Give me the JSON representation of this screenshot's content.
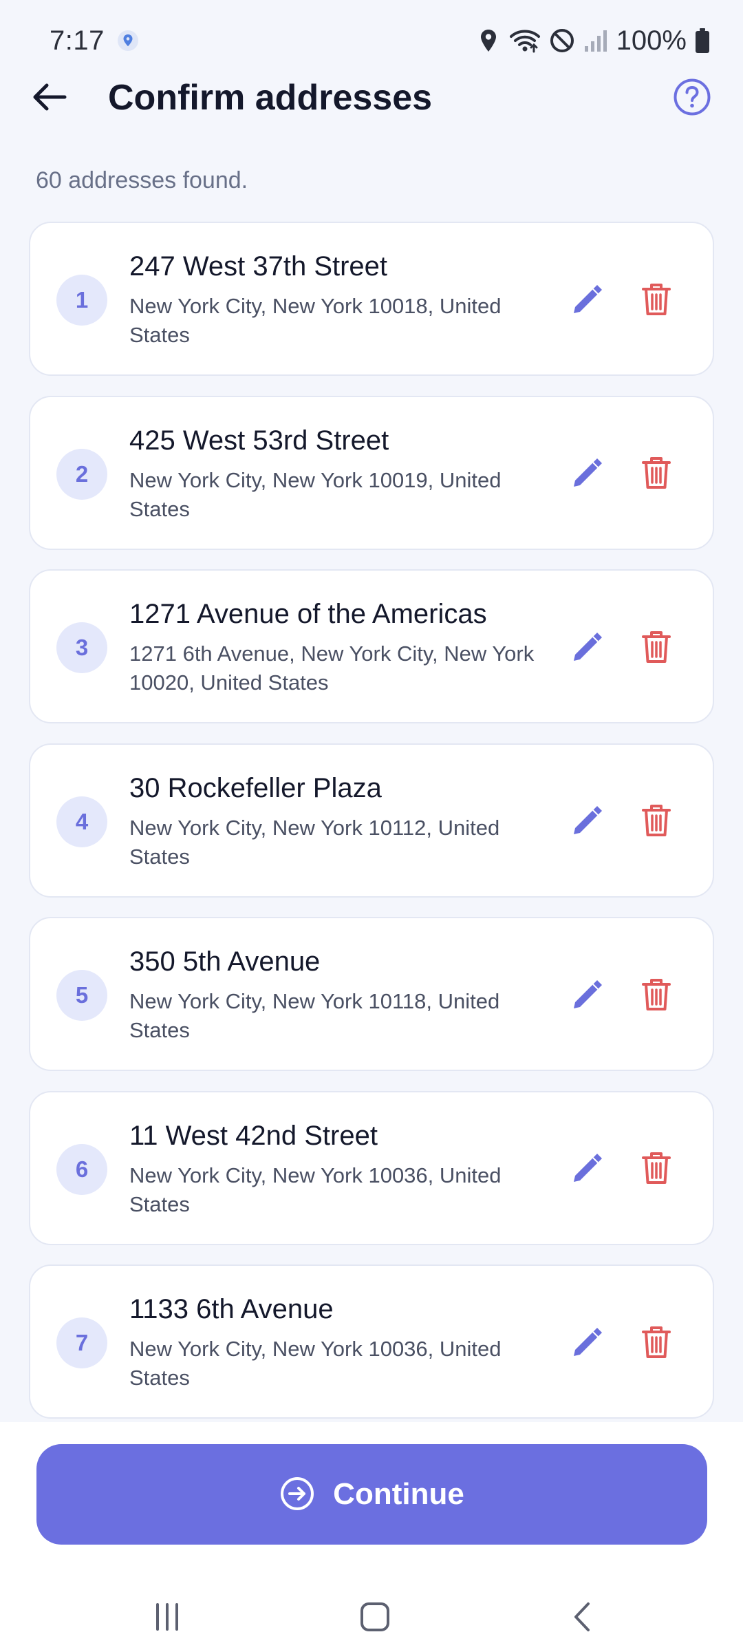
{
  "status_bar": {
    "time": "7:17",
    "battery": "100%",
    "icons": [
      "location-pin-badge-icon",
      "location-icon",
      "wifi-icon",
      "do-not-disturb-icon",
      "signal-icon",
      "battery-icon"
    ]
  },
  "header": {
    "title": "Confirm addresses",
    "back_icon": "arrow-left-icon",
    "help_icon": "help-circle-icon"
  },
  "summary": {
    "found_text": "60 addresses found."
  },
  "addresses": [
    {
      "num": "1",
      "title": "247 West 37th Street",
      "subtitle": "New York City, New York 10018, United States"
    },
    {
      "num": "2",
      "title": "425 West 53rd Street",
      "subtitle": "New York City, New York 10019, United States"
    },
    {
      "num": "3",
      "title": "1271 Avenue of the Americas",
      "subtitle": "1271 6th Avenue, New York City, New York 10020, United States"
    },
    {
      "num": "4",
      "title": "30 Rockefeller Plaza",
      "subtitle": "New York City, New York 10112, United States"
    },
    {
      "num": "5",
      "title": "350 5th Avenue",
      "subtitle": "New York City, New York 10118, United States"
    },
    {
      "num": "6",
      "title": "11 West 42nd Street",
      "subtitle": "New York City, New York 10036, United States"
    },
    {
      "num": "7",
      "title": "1133 6th Avenue",
      "subtitle": "New York City, New York 10036, United States"
    }
  ],
  "actions": {
    "continue_label": "Continue",
    "continue_icon": "arrow-right-circle-icon"
  },
  "colors": {
    "accent": "#6b6fe0",
    "edit": "#6a6fdc",
    "delete": "#e05a5a",
    "badge_bg": "#e4e8fb",
    "background": "#f4f6fc"
  }
}
